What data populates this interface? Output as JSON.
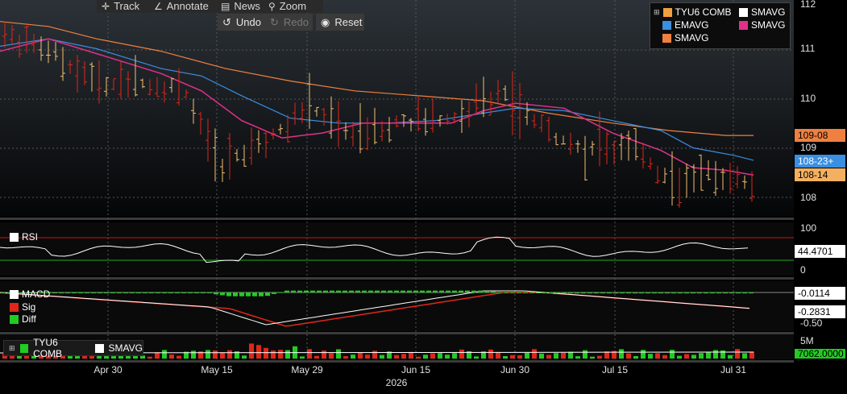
{
  "toolbar": {
    "track": "Track",
    "annotate": "Annotate",
    "news": "News",
    "zoom": "Zoom",
    "undo": "Undo",
    "redo": "Redo",
    "reset": "Reset"
  },
  "legend": {
    "items": [
      {
        "label": "TYU6 COMB",
        "color": "#f0a040"
      },
      {
        "label": "SMAVG",
        "color": "#ffffff"
      },
      {
        "label": "EMAVG",
        "color": "#3a8fe0"
      },
      {
        "label": "SMAVG",
        "color": "#e0308a"
      },
      {
        "label": "SMAVG",
        "color": "#f08040"
      }
    ]
  },
  "price_axis": {
    "labels": [
      "112",
      "111",
      "110",
      "109",
      "108"
    ]
  },
  "price_tags": {
    "smavg_orange": "109-08",
    "emavg": "108-23+",
    "last": "108-14"
  },
  "rsi": {
    "label": "RSI",
    "axis": [
      "100",
      "0"
    ],
    "value": "44.4701"
  },
  "macd": {
    "labels": {
      "macd": "MACD",
      "sig": "Sig",
      "diff": "Diff"
    },
    "values": {
      "macd": "-0.0114",
      "sig": "-0.2831"
    },
    "axis": "-0.50"
  },
  "volume": {
    "legend": {
      "series": "TYU6 COMB",
      "avg": "SMAVG"
    },
    "axis": "5M",
    "value": "7062.0000"
  },
  "x_axis": {
    "labels": [
      "Apr 30",
      "May 15",
      "May 29",
      "Jun 15",
      "Jun 30",
      "Jul 15",
      "Jul 31"
    ],
    "year": "2026"
  },
  "colors": {
    "up": "#f4c070",
    "down": "#e0261a",
    "ema": "#3a8fe0",
    "sma_pink": "#e0308a",
    "sma_orange": "#f08040",
    "grid": "#555"
  }
}
